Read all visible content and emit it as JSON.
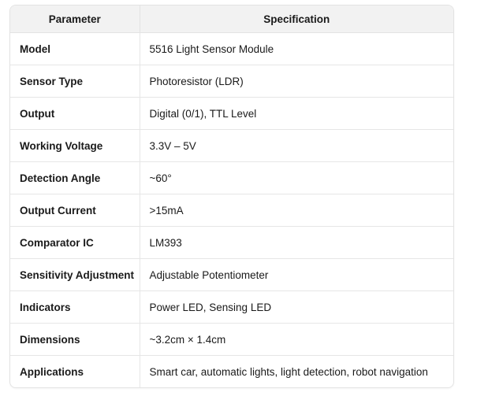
{
  "table": {
    "headers": [
      "Parameter",
      "Specification"
    ],
    "rows": [
      {
        "parameter": "Model",
        "specification": "5516 Light Sensor Module"
      },
      {
        "parameter": "Sensor Type",
        "specification": "Photoresistor (LDR)"
      },
      {
        "parameter": "Output",
        "specification": "Digital (0/1), TTL Level"
      },
      {
        "parameter": "Working Voltage",
        "specification": "3.3V – 5V"
      },
      {
        "parameter": "Detection Angle",
        "specification": "~60°"
      },
      {
        "parameter": "Output Current",
        "specification": ">15mA"
      },
      {
        "parameter": "Comparator IC",
        "specification": "LM393"
      },
      {
        "parameter": "Sensitivity Adjustment",
        "specification": "Adjustable Potentiometer"
      },
      {
        "parameter": "Indicators",
        "specification": "Power LED, Sensing LED"
      },
      {
        "parameter": "Dimensions",
        "specification": "~3.2cm × 1.4cm"
      },
      {
        "parameter": "Applications",
        "specification": "Smart car, automatic lights, light detection, robot navigation"
      }
    ]
  }
}
